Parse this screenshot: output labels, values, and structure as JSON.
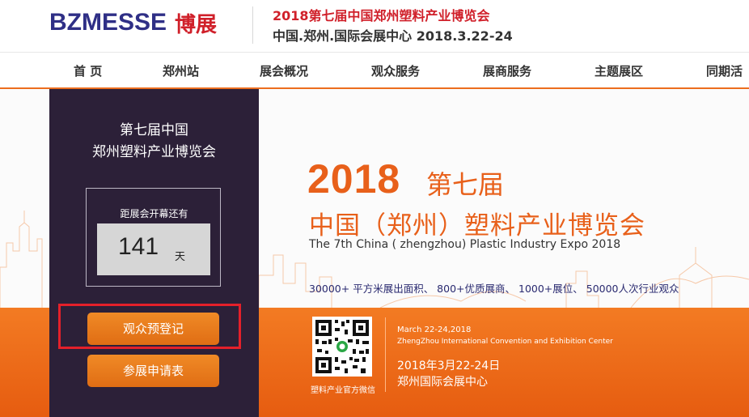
{
  "header": {
    "logo_en": "BZMESSE",
    "logo_cn": "博展",
    "title": "2018第七届中国郑州塑料产业博览会",
    "subtitle": "中国.郑州.国际会展中心  2018.3.22-24"
  },
  "nav": {
    "items": [
      "首 页",
      "郑州站",
      "展会概况",
      "观众服务",
      "展商服务",
      "主题展区",
      "同期活"
    ]
  },
  "sidebar": {
    "title_line1": "第七届中国",
    "title_line2": "郑州塑料产业博览会",
    "countdown_label": "距展会开幕还有",
    "countdown_value": "141",
    "countdown_unit": "天",
    "register_button": "观众预登记",
    "apply_button": "参展申请表"
  },
  "banner": {
    "year": "2018",
    "edition": "第七届",
    "title_cn": "中国（郑州）塑料产业博览会",
    "title_en": "The 7th China ( zhengzhou) Plastic Industry Expo 2018",
    "stats": "30000+ 平方米展出面积、 800+优质展商、 1000+展位、 50000人次行业观众",
    "qr_caption": "塑料产业官方微信",
    "date_en": "March 22-24,2018",
    "venue_en": "ZhengZhou International Convention and Exhibition Center",
    "date_cn": "2018年3月22-24日",
    "venue_cn": "郑州国际会展中心"
  },
  "colors": {
    "brand_blue": "#2f2f86",
    "brand_red": "#d0202a",
    "accent_orange": "#e8601a",
    "sidebar_bg": "#2c2038",
    "highlight": "#e4202a"
  }
}
